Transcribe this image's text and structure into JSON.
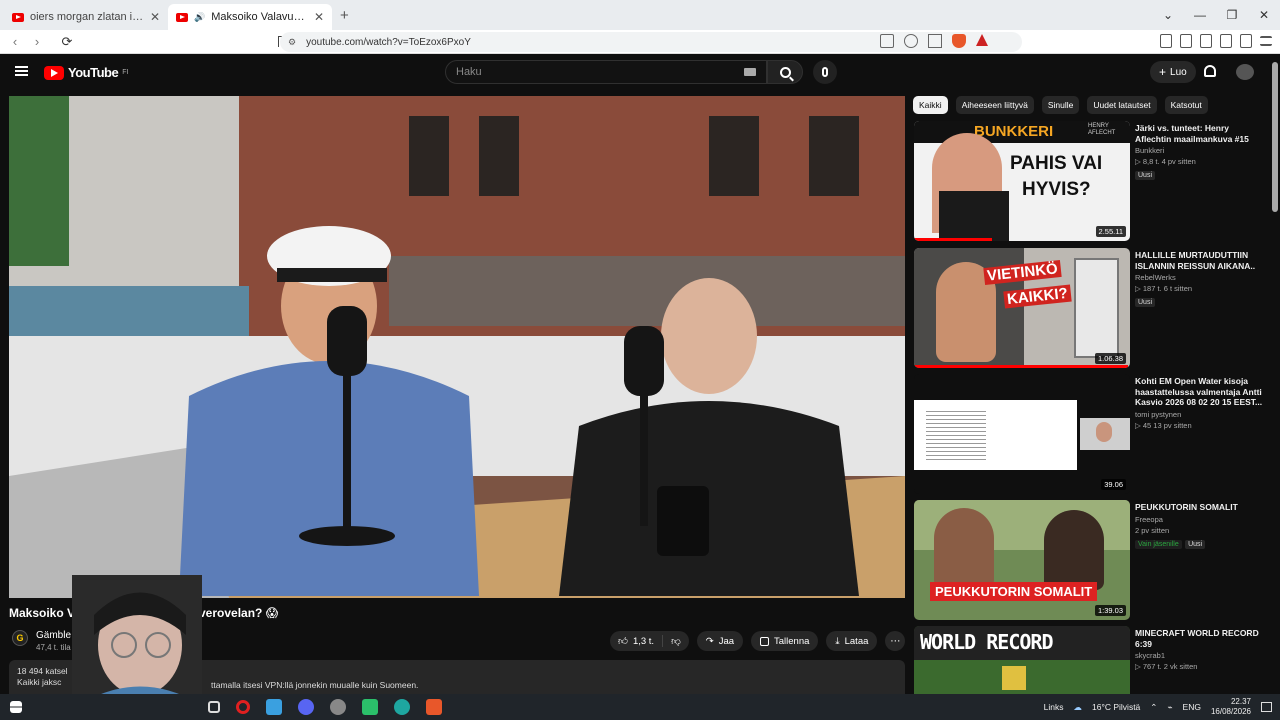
{
  "browser": {
    "tabs": [
      {
        "title": "oiers morgan zlatan ibrahimovic - Yo",
        "active": false
      },
      {
        "title": "Maksoiko Valavuori jatkmilijo",
        "active": true
      }
    ],
    "new_tab": "+",
    "url": "youtube.com/watch?v=ToEzox6PxoY"
  },
  "youtube": {
    "logo": "YouTube",
    "logo_region": "FI",
    "search_placeholder": "Haku",
    "create_label": "Luo"
  },
  "video": {
    "title_start": "Maksoiko Val",
    "title_end": "verovelan? 😱",
    "channel_avatar": "G",
    "channel_name": "Gämble",
    "channel_subs": "47,4 t. tila",
    "actions": {
      "like": "1,3 t.",
      "share": "Jaa",
      "save": "Tallenna",
      "download": "Lataa",
      "more": "⋯"
    },
    "desc_line1": "18 494 katsel",
    "desc_line2": "Kaikki jaksc",
    "desc_extra": "ttamalla itsesi VPN:llä jonnekin muualle kuin Suomeen."
  },
  "sidebar": {
    "chips": [
      "Kaikki",
      "Aiheeseen liittyvä",
      "Sinulle",
      "Uudet latautset",
      "Katsotut"
    ],
    "recs": [
      {
        "title": "Järki vs. tunteet: Henry Aflechtin maailmankuva #15",
        "channel": "Bunkkeri",
        "meta": "▷ 8,8 t.  4 pv sitten",
        "badge": "Uusi",
        "duration": "2.55.11",
        "thumb_text1": "BUNKKERI",
        "thumb_text2": "PAHIS VAI",
        "thumb_text3": "HYVIS?",
        "thumb_small": "HENRY AFLECHT",
        "progress": 0.36
      },
      {
        "title": "HALLILLE MURTAUDUTTIIN ISLANNIN REISSUN AIKANA..",
        "channel": "RebelWerks",
        "meta": "▷ 187 t.  6 t sitten",
        "badge": "Uusi",
        "duration": "1.06.38",
        "thumb_text1": "VIETINKÖ",
        "thumb_text2": "KAIKKI?",
        "progress": 0.99
      },
      {
        "title": "Kohti EM Open Water kisoja haastattelussa valmentaja Antti Kasvio 2026 08 02 20 15 EEST...",
        "channel": "tomi pystynen",
        "meta": "▷ 45  13 pv sitten",
        "badge": "",
        "duration": "39.06"
      },
      {
        "title": "PEUKKUTORIN SOMALIT",
        "channel": "Freeopa",
        "meta": "2 pv sitten",
        "member": "Vain jäsenille",
        "badge": "Uusi",
        "duration": "1:39.03",
        "thumb_text1": "PEUKKUTORIN SOMALIT"
      },
      {
        "title": "MINECRAFT WORLD RECORD 6:39",
        "channel": "skycrab1",
        "meta": "▷ 767 t.  2 vk sitten",
        "badge": "",
        "duration": "",
        "thumb_text1": "WORLD RECORD"
      }
    ]
  },
  "taskbar": {
    "links": "Links",
    "weather": "16°C Pilvistä",
    "lang": "ENG",
    "time": "22.37",
    "date": "16/08/2026"
  }
}
